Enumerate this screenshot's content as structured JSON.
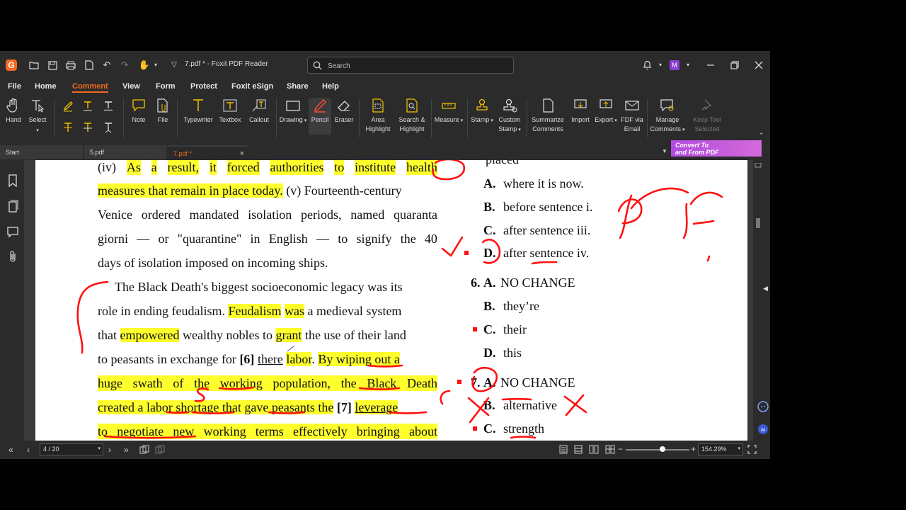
{
  "window": {
    "title": "7.pdf * - Foxit PDF Reader",
    "avatar_letter": "M"
  },
  "search": {
    "placeholder": "Search"
  },
  "menu": [
    "File",
    "Home",
    "Comment",
    "View",
    "Form",
    "Protect",
    "Foxit eSign",
    "Share",
    "Help"
  ],
  "active_menu": "Comment",
  "ribbon": {
    "hand": "Hand",
    "select": "Select",
    "note": "Note",
    "file": "File",
    "typewriter": "Typewriter",
    "textbox": "Textbox",
    "callout": "Callout",
    "drawing": "Drawing",
    "pencil": "Pencil",
    "eraser": "Eraser",
    "area_highlight_1": "Area",
    "area_highlight_2": "Highlight",
    "search_highlight_1": "Search &",
    "search_highlight_2": "Highlight",
    "measure": "Measure",
    "stamp": "Stamp",
    "custom_stamp_1": "Custom",
    "custom_stamp_2": "Stamp",
    "summarize_1": "Summarize",
    "summarize_2": "Comments",
    "import": "Import",
    "export": "Export",
    "fdf_1": "FDF via",
    "fdf_2": "Email",
    "manage_1": "Manage",
    "manage_2": "Comments",
    "keep_1": "Keep Tool",
    "keep_2": "Selected"
  },
  "tabs": {
    "start": "Start",
    "tab1": "5.pdf",
    "tab2": "7.pdf *"
  },
  "convert": {
    "line1": "Convert To",
    "line2": "and From PDF"
  },
  "passage": {
    "l1": [
      "(iv)",
      "As",
      "a",
      "result,",
      "it",
      "forced",
      "authorities",
      "to",
      "institute",
      "health"
    ],
    "l2a": "measures that remain in place today.",
    "l2b": " (v) Fourteenth-century",
    "l3": [
      "Venice",
      "ordered",
      "mandated",
      "isolation",
      "periods,",
      "named",
      "quaranta"
    ],
    "l4": [
      "giorni",
      "—",
      "or",
      "\"quarantine\"",
      "in",
      "English",
      "—",
      "to",
      "signify",
      "the",
      "40"
    ],
    "l5": "days of isolation imposed on incoming ships.",
    "l6": "The Black Death's biggest socioeconomic legacy was its",
    "l7a": "role in ending feudalism. ",
    "l7b": "Feudalism",
    "l7c": "was",
    "l7d": " a medieval system",
    "l8a": "that ",
    "l8b": "empowered",
    "l8c": " wealthy nobles to ",
    "l8d": "grant",
    "l8e": " the use of their land",
    "l9a": "to peasants in exchange for ",
    "l9b": "[6]",
    "l9c": "there",
    "l9d": "labor",
    "l9e": "By wiping out a",
    "l10": "huge swath of the working population, the Black Death",
    "l11a": "created a labor shortage that gave peasants the",
    "l11b": "[7]",
    "l11c": "leverage",
    "l12": "to negotiate new working terms effectively bringing about"
  },
  "questions": {
    "prev_tail": "placed",
    "q5": [
      {
        "key": "A.",
        "text": "where it is now."
      },
      {
        "key": "B.",
        "text": "before sentence i."
      },
      {
        "key": "C.",
        "text": "after sentence iii."
      },
      {
        "key": "D.",
        "text": "after sentence iv."
      }
    ],
    "q6_num": "6.",
    "q6": [
      {
        "key": "A.",
        "text": "NO CHANGE"
      },
      {
        "key": "B.",
        "text": "they’re"
      },
      {
        "key": "C.",
        "text": "their"
      },
      {
        "key": "D.",
        "text": "this"
      }
    ],
    "q7_num": "7.",
    "q7": [
      {
        "key": "A.",
        "text": "NO CHANGE"
      },
      {
        "key": "B.",
        "text": "alternative"
      },
      {
        "key": "C.",
        "text": "strength"
      }
    ]
  },
  "status": {
    "page": "4 / 20",
    "zoom": "154.29%"
  },
  "colors": {
    "accent": "#f26a21",
    "highlight": "#ffff2e",
    "ink": "#ff0000",
    "convert_banner": "#c35add"
  }
}
